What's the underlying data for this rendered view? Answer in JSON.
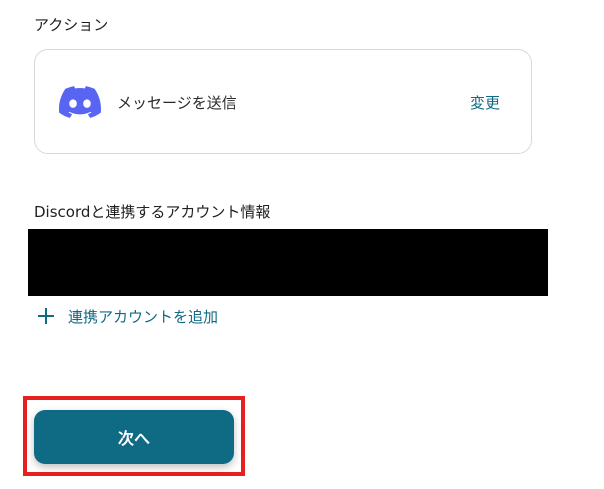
{
  "action_section": {
    "title": "アクション",
    "card": {
      "icon": "discord-icon",
      "icon_color": "#5865F2",
      "label": "メッセージを送信",
      "change_label": "変更"
    }
  },
  "account_section": {
    "title": "Discordと連携するアカウント情報",
    "add_account_label": "連携アカウントを追加",
    "add_icon": "plus-icon"
  },
  "footer": {
    "next_button_label": "次へ"
  },
  "colors": {
    "accent": "#0f6a84",
    "highlight": "#e5201e",
    "redaction": "#000000"
  }
}
